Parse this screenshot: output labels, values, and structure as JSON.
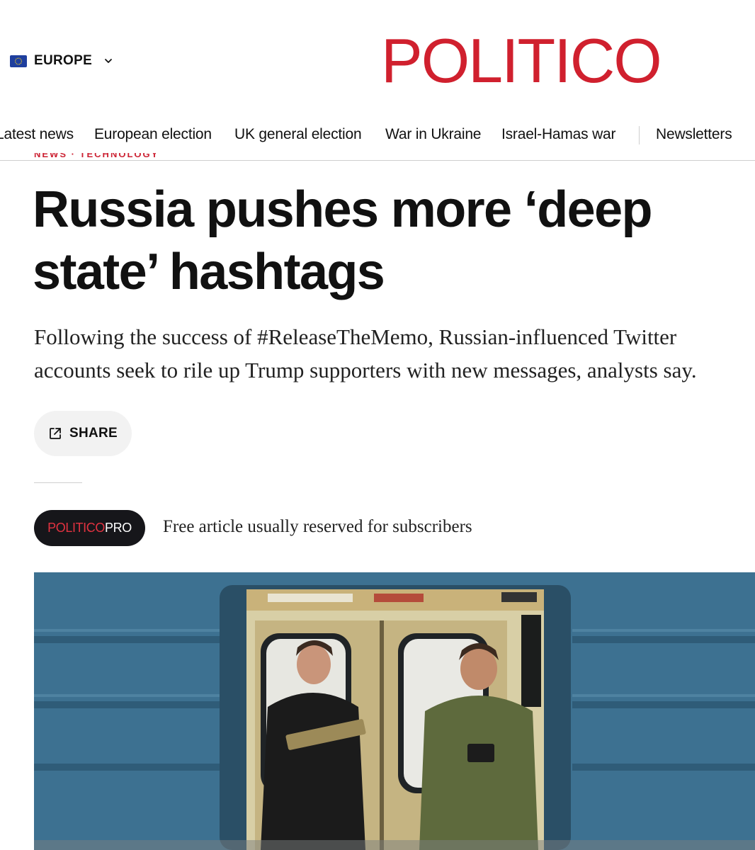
{
  "header": {
    "edition_label": "EUROPE",
    "logo_text": "POLITICO"
  },
  "nav": {
    "items": [
      {
        "label": "Latest news"
      },
      {
        "label": "European election"
      },
      {
        "label": "UK general election"
      },
      {
        "label": "War in Ukraine"
      },
      {
        "label": "Israel-Hamas war"
      },
      {
        "label": "Newsletters"
      }
    ]
  },
  "article": {
    "kicker": "NEWS · TECHNOLOGY",
    "headline": "Russia pushes more ‘deep state’ hashtags",
    "dek": "Following the success of #ReleaseTheMemo, Russian-influenced Twitter accounts seek to rile up Trump supporters with new messages, analysts say.",
    "share_label": "SHARE",
    "pro_badge_part1": "POLITICO",
    "pro_badge_part2": "PRO",
    "pro_note": "Free article usually reserved for subscribers"
  },
  "colors": {
    "brand_red": "#d0202e",
    "pro_badge_bg": "#16161a",
    "train_blue": "#3d7191"
  },
  "icons": {
    "edition_flag": "eu-flag-icon",
    "edition_chevron": "chevron-down-icon",
    "share": "share-external-icon"
  }
}
